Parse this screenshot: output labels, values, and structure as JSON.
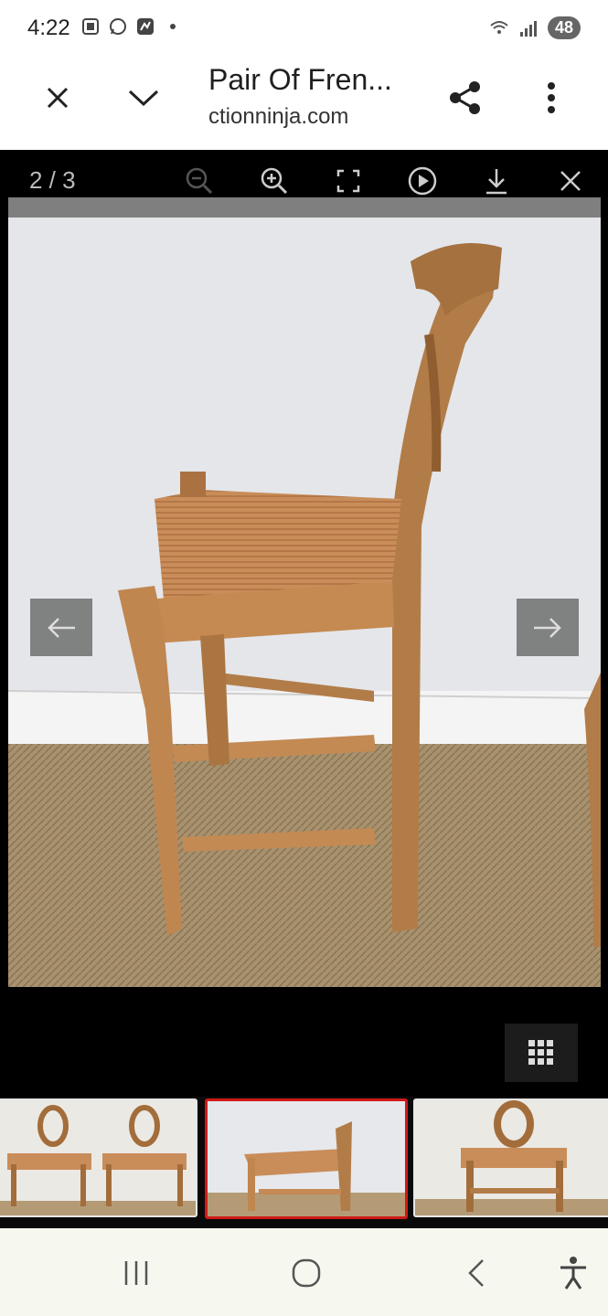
{
  "status": {
    "time": "4:22",
    "battery": "48",
    "icons": [
      "screenshot-icon",
      "whatsapp-icon",
      "app-notification-icon",
      "wifi-icon",
      "signal-icon"
    ]
  },
  "toolbar": {
    "title": "Pair Of Fren...",
    "url": "ctionninja.com",
    "icons": [
      "close-icon",
      "chevron-down-icon",
      "share-icon",
      "more-vert-icon"
    ]
  },
  "viewer": {
    "counter": "2 / 3",
    "tools": [
      "zoom-out-icon",
      "zoom-in-icon",
      "fullscreen-icon",
      "play-icon",
      "download-icon",
      "close-icon"
    ],
    "prev_icon": "arrow-left-icon",
    "next_icon": "arrow-right-icon",
    "grid_icon": "grid-icon",
    "active_thumbnail": 2,
    "thumbnails": [
      "thumbnail-1",
      "thumbnail-2",
      "thumbnail-3"
    ]
  },
  "colors": {
    "accent_active_border": "#d01818",
    "viewer_bg": "#000000",
    "nav_bg": "#f6f8ef"
  },
  "navbar": {
    "icons": [
      "recent-apps-icon",
      "home-icon",
      "back-icon",
      "accessibility-icon"
    ]
  }
}
